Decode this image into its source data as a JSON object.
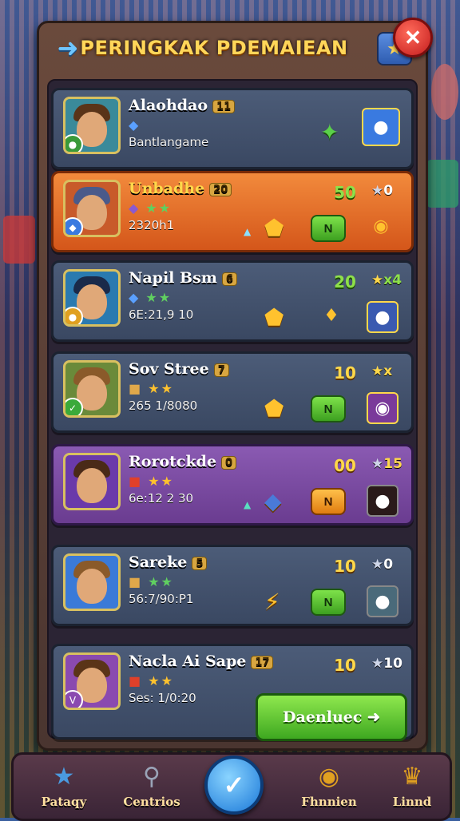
{
  "header": {
    "title": "PERINGKAK PDEMAIEAN",
    "back_icon": "back-arrow-icon",
    "star_icon": "star-icon",
    "close_icon": "close-icon"
  },
  "rows": [
    {
      "name": "Alaohdao",
      "level": "11",
      "icons": "gem",
      "subtitle": "Bantlangame",
      "score": "",
      "stars": "",
      "mid_icon": "✦",
      "pill": "",
      "accent": "#4c5c78"
    },
    {
      "name": "Unbadhe",
      "level": "20",
      "icons": "gem-stars",
      "subtitle": "2320h1",
      "score": "50",
      "stars": "0",
      "mid_icon": "⬟",
      "pill": "N",
      "accent": "#f28a3c"
    },
    {
      "name": "Napil Bsm",
      "level": "6",
      "icons": "gem-stars",
      "subtitle": "6E:21,9 10",
      "score": "20",
      "stars": "x4",
      "mid_icon": "⬟",
      "pill": "",
      "accent": "#4c5c78"
    },
    {
      "name": "Sov Stree",
      "level": "7",
      "icons": "box-stars",
      "subtitle": "265 1/8080",
      "score": "10",
      "stars": "x",
      "mid_icon": "⬟",
      "pill": "N",
      "accent": "#4c5c78"
    },
    {
      "name": "Rorotckde",
      "level": "0",
      "icons": "red-stars",
      "subtitle": "6e:12 2 30",
      "score": "00",
      "stars": "15",
      "mid_icon": "◆",
      "pill": "N",
      "accent": "#8a5ab2"
    },
    {
      "name": "Sareke",
      "level": "5",
      "icons": "box-stars",
      "subtitle": "56:7/90:P1",
      "score": "10",
      "stars": "0",
      "mid_icon": "⚡",
      "pill": "N",
      "accent": "#4c5c78"
    },
    {
      "name": "Nacla Ai Sape",
      "level": "17",
      "icons": "red-stars",
      "subtitle": "Ses: 1/0:20",
      "score": "10",
      "stars": "10",
      "mid_icon": "",
      "pill": "",
      "accent": "#4c5c78"
    }
  ],
  "cta": {
    "label": "Daenluec ➜"
  },
  "nav": [
    {
      "label": "Pataqy",
      "icon": "star-badge-icon"
    },
    {
      "label": "Centrios",
      "icon": "magnifier-icon"
    },
    {
      "label": "Fhnnien",
      "icon": "donut-icon"
    },
    {
      "label": "Linnd",
      "icon": "crown-icon"
    }
  ],
  "nav_center_icon": "check-icon"
}
